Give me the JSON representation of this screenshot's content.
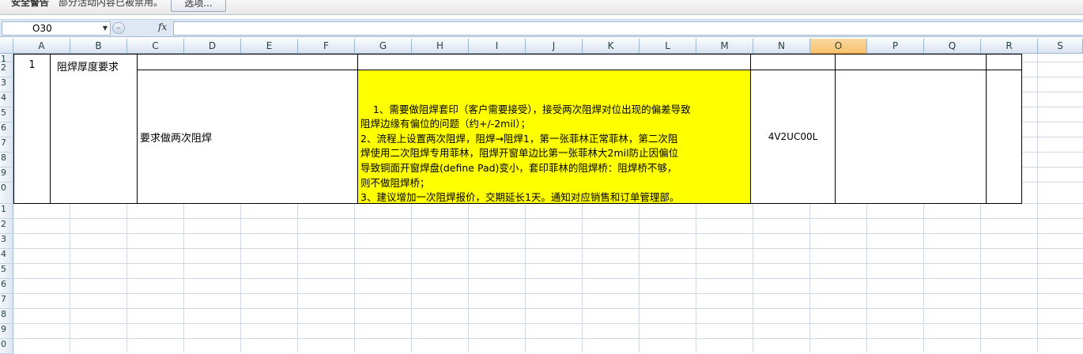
{
  "security_bar": {
    "title": "安全警告",
    "message": "部分活动内容已被禁用。",
    "options_button": "选项..."
  },
  "formula_bar": {
    "name_box": "O30",
    "fx_label": "fx",
    "formula": ""
  },
  "columns": [
    "A",
    "B",
    "C",
    "D",
    "E",
    "F",
    "G",
    "H",
    "I",
    "J",
    "K",
    "L",
    "M",
    "N",
    "O",
    "P",
    "Q",
    "R",
    "S"
  ],
  "selected_column": "O",
  "row_numbers": [
    "1",
    "2",
    "3",
    "4",
    "5",
    "6",
    "7",
    "8",
    "9",
    "0",
    "1",
    "2",
    "3",
    "4",
    "5",
    "6",
    "7",
    "8",
    "9",
    "0"
  ],
  "cells": {
    "item_number": "1",
    "requirement": "阻焊厚度要求",
    "detail_title": "要求做两次阻焊",
    "detail_notes": "1、需要做阻焊套印（客户需要接受），接受两次阻焊对位出现的偏差导致\n阻焊边缘有偏位的问题（约+/-2mil）；\n2、流程上设置两次阻焊，阻焊→阻焊1，第一张菲林正常菲林，第二次阻\n焊使用二次阻焊专用菲林，阻焊开窗单边比第一张菲林大2mil防止因偏位\n导致铜面开窗焊盘(define Pad)变小，套印菲林的阻焊桥：阻焊桥不够，\n则不做阻焊桥；\n3、建议增加一次阻焊报价，交期延长1天。通知对应销售和订单管理部。",
    "part_code": "4V2UC00L"
  },
  "colors": {
    "highlight": "#ffff00",
    "selected_header": "#f7c36d",
    "gridline": "#d0d7e5"
  }
}
